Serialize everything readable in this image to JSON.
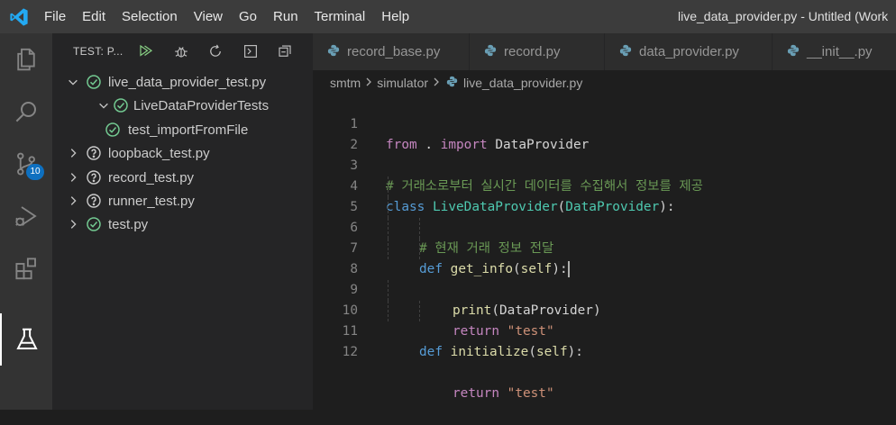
{
  "menu": [
    "File",
    "Edit",
    "Selection",
    "View",
    "Go",
    "Run",
    "Terminal",
    "Help"
  ],
  "window_title": "live_data_provider.py - Untitled (Work",
  "activity_bar": {
    "items": [
      "explorer-icon",
      "search-icon",
      "source-control-icon",
      "run-debug-icon",
      "extensions-icon",
      "testing-icon"
    ],
    "source_control_badge": "10",
    "active": "testing-icon"
  },
  "sidebar": {
    "title": "TEST: P...",
    "toolbar": [
      "run-all-icon",
      "debug-all-icon",
      "refresh-icon",
      "terminal-icon",
      "collapse-all-icon"
    ],
    "tree": [
      {
        "label": "live_data_provider_test.py",
        "status": "passed",
        "expanded": true,
        "level": 0
      },
      {
        "label": "LiveDataProviderTests",
        "status": "passed",
        "expanded": true,
        "level": 1
      },
      {
        "label": "test_importFromFile",
        "status": "passed",
        "level": 2
      },
      {
        "label": "loopback_test.py",
        "status": "unknown",
        "expanded": false,
        "level": 0
      },
      {
        "label": "record_test.py",
        "status": "unknown",
        "expanded": false,
        "level": 0
      },
      {
        "label": "runner_test.py",
        "status": "unknown",
        "expanded": false,
        "level": 0
      },
      {
        "label": "test.py",
        "status": "passed",
        "expanded": false,
        "level": 0
      }
    ]
  },
  "tabs": [
    "record_base.py",
    "record.py",
    "data_provider.py",
    "__init__.py"
  ],
  "breadcrumb": [
    "smtm",
    "simulator",
    "live_data_provider.py"
  ],
  "code": {
    "line_numbers": [
      "1",
      "2",
      "3",
      "4",
      "5",
      "6",
      "7",
      "8",
      "9",
      "10",
      "11",
      "12"
    ],
    "l1": {
      "from": "from",
      "dot": ".",
      "import": "import",
      "name": "DataProvider"
    },
    "l3": {
      "comment": "# 거래소로부터 실시간 데이터를 수집해서 정보를 제공"
    },
    "l4": {
      "class": "class",
      "name": "LiveDataProvider",
      "open": "(",
      "base": "DataProvider",
      "close": "):"
    },
    "l5": {
      "comment": "# 현재 거래 정보 전달"
    },
    "l6": {
      "def": "def",
      "name": "get_info",
      "open": "(",
      "self": "self",
      "close": "):"
    },
    "l7": {
      "print": "print",
      "open": "(",
      "arg": "DataProvider",
      "close": ")"
    },
    "l8": {
      "return": "return",
      "value": "\"test\""
    },
    "l10": {
      "def": "def",
      "name": "initialize",
      "open": "(",
      "self": "self",
      "close": "):"
    },
    "l11": {
      "return": "return",
      "value": "\"test\""
    }
  },
  "colors": {
    "keyword": "#569cd6",
    "control": "#c586c0",
    "function": "#dcdcaa",
    "class": "#4ec9b0",
    "string": "#ce9178",
    "comment": "#6a9955",
    "passed": "#73c991",
    "unknown": "#cccccc",
    "badge": "#0e70c0"
  }
}
